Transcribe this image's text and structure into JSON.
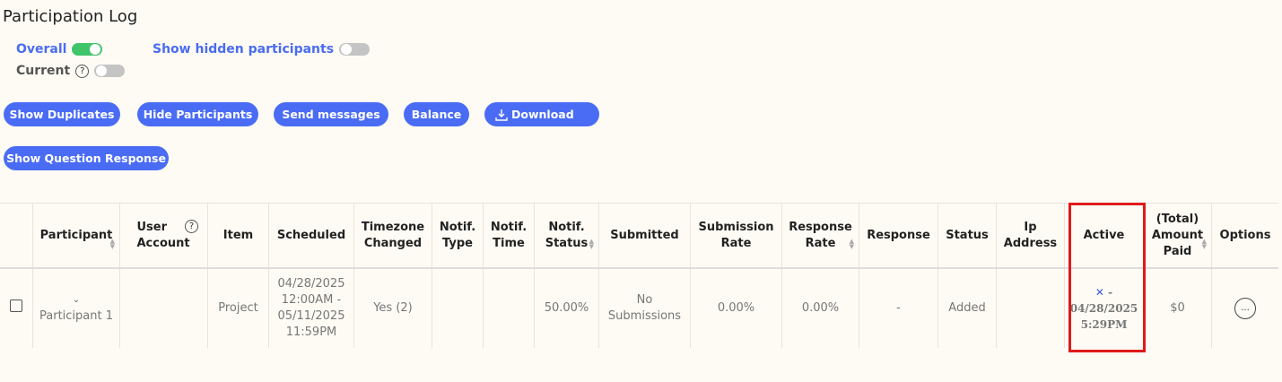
{
  "page": {
    "title": "Participation Log"
  },
  "toggles": {
    "overall": {
      "label": "Overall",
      "on": true
    },
    "current": {
      "label": "Current",
      "on": false
    },
    "hidden": {
      "label": "Show hidden participants",
      "on": false
    }
  },
  "actions": {
    "show_duplicates": "Show Duplicates",
    "hide_participants": "Hide Participants",
    "send_messages": "Send messages",
    "balance": "Balance",
    "download": "Download",
    "show_question_response": "Show Question Response"
  },
  "table": {
    "headers": {
      "participant": "Participant",
      "user_account": "User Account",
      "item": "Item",
      "scheduled": "Scheduled",
      "timezone_changed": "Timezone Changed",
      "notif_type": "Notif. Type",
      "notif_time": "Notif. Time",
      "notif_status": "Notif. Status",
      "submitted": "Submitted",
      "submission_rate": "Submission Rate",
      "response_rate": "Response Rate",
      "response": "Response",
      "status": "Status",
      "ip_address": "Ip Address",
      "active": "Active",
      "total_amount_paid": "(Total) Amount Paid",
      "options": "Options"
    },
    "rows": [
      {
        "participant": "Participant 1",
        "user_account": "",
        "item": "Project",
        "scheduled_start": "04/28/2025 12:00AM -",
        "scheduled_end": "05/11/2025 11:59PM",
        "timezone_changed": "Yes (2)",
        "notif_type": "",
        "notif_time": "",
        "notif_status": "50.00%",
        "submitted": "No Submissions",
        "submission_rate": "0.00%",
        "response_rate": "0.00%",
        "response": "-",
        "status": "Added",
        "ip_address": "",
        "active_mark": "✕",
        "active_dash": " -",
        "active_date": "04/28/2025",
        "active_time": "5:29PM",
        "amount_paid": "$0",
        "options_glyph": "..."
      }
    ]
  },
  "colors": {
    "accent": "#4a6cf5",
    "toggle_on": "#3fc46a",
    "highlight": "#e01a1a"
  }
}
